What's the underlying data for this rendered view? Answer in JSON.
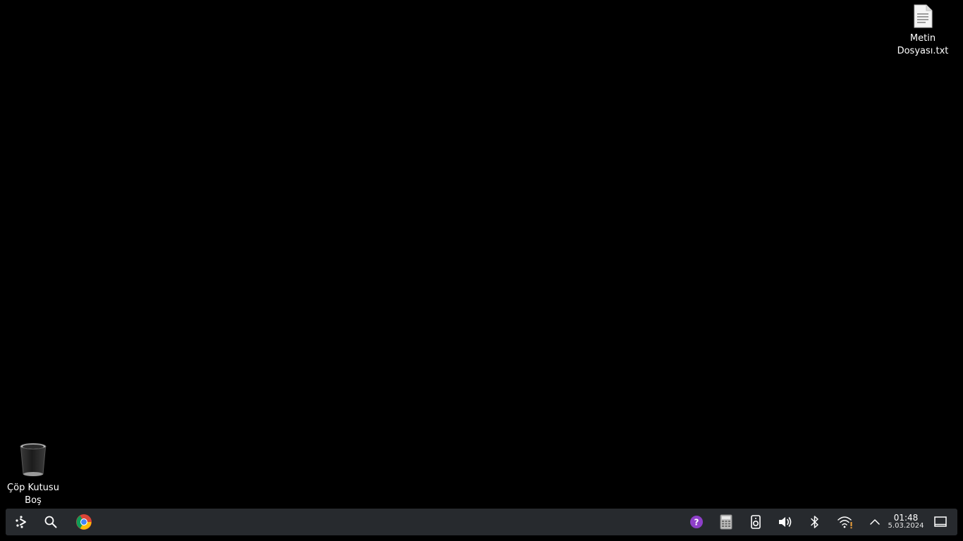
{
  "desktop": {
    "background_color": "#000000",
    "icons": [
      {
        "name": "text-file",
        "label_line1": "Metin",
        "label_line2": "Dosyası.txt",
        "icon": "text-file-icon"
      },
      {
        "name": "trash",
        "label_line1": "Çöp Kutusu",
        "label_line2": "Boş",
        "icon": "trash-bin-icon"
      }
    ]
  },
  "taskbar": {
    "background_color": "#272a2e",
    "left_items": [
      {
        "name": "app-launcher",
        "icon": "launcher-icon"
      },
      {
        "name": "search",
        "icon": "search-icon"
      },
      {
        "name": "chrome",
        "icon": "chrome-icon"
      }
    ],
    "tray_items": [
      {
        "name": "help",
        "icon": "help-icon",
        "color": "#8e3fc9"
      },
      {
        "name": "calculator",
        "icon": "calculator-icon"
      },
      {
        "name": "media-player",
        "icon": "speaker-device-icon"
      },
      {
        "name": "volume",
        "icon": "volume-icon"
      },
      {
        "name": "bluetooth",
        "icon": "bluetooth-icon"
      },
      {
        "name": "network",
        "icon": "wifi-warning-icon"
      },
      {
        "name": "show-hidden",
        "icon": "chevron-up-icon"
      },
      {
        "name": "show-desktop",
        "icon": "show-desktop-icon"
      }
    ],
    "clock": {
      "time": "01:48",
      "date": "5.03.2024"
    }
  }
}
